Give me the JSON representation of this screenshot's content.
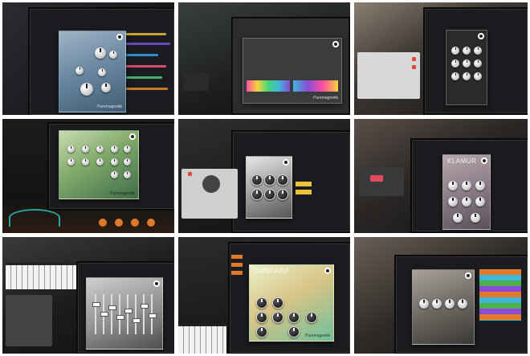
{
  "tiles": [
    {
      "title": "",
      "brand": "Puremagnetik"
    },
    {
      "title": "",
      "brand": "Puremagnetik"
    },
    {
      "title": "",
      "brand": ""
    },
    {
      "title": "",
      "brand": "Puremagnetik"
    },
    {
      "title": "",
      "brand": ""
    },
    {
      "title": "KLAMUR",
      "brand": ""
    },
    {
      "title": "",
      "brand": ""
    },
    {
      "title": "OMNI-ARP",
      "brand": "Puremagnetik"
    },
    {
      "title": "",
      "brand": ""
    }
  ],
  "colors": {
    "grid_gap": "#ffffff",
    "accent_orange": "#e07a2a",
    "accent_cyan": "#3fb6d8",
    "accent_green": "#4caf50",
    "accent_purple": "#8a4bd6"
  }
}
